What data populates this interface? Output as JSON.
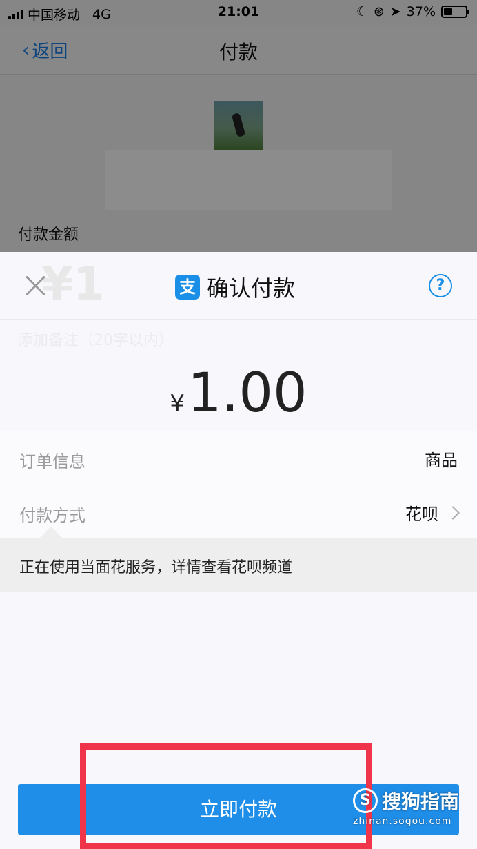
{
  "status_bar": {
    "carrier": "中国移动",
    "network": "4G",
    "time": "21:01",
    "battery": "37%"
  },
  "nav": {
    "back_label": "返回",
    "title": "付款"
  },
  "background_page": {
    "amount_label": "付款金额",
    "ghost_amount": "¥1",
    "ghost_text": "添加备注（20字以内）"
  },
  "sheet": {
    "title": "确认付款",
    "alipay_glyph": "支",
    "help_glyph": "?",
    "currency": "¥",
    "amount": "1.00",
    "order_label": "订单信息",
    "order_value": "商品",
    "method_label": "付款方式",
    "method_value": "花呗",
    "notice": "正在使用当面花服务，详情查看花呗频道",
    "pay_button": "立即付款"
  },
  "watermark": {
    "logo_glyph": "S",
    "brand": "搜狗指南",
    "url": "zhinan.sogou.com"
  },
  "colors": {
    "accent": "#1f8ee9",
    "highlight": "#f0344a"
  }
}
